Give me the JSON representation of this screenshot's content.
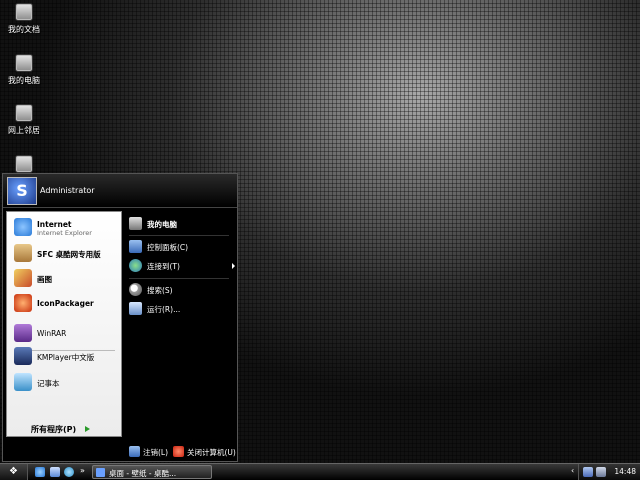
{
  "desktop_icons": [
    {
      "label": "我的文档",
      "icon": "my-documents-icon"
    },
    {
      "label": "我的电脑",
      "icon": "my-computer-icon"
    },
    {
      "label": "网上邻居",
      "icon": "network-places-icon"
    },
    {
      "label": "",
      "icon": "recycle-bin-icon"
    }
  ],
  "start_menu": {
    "user_name": "Administrator",
    "avatar_glyph": "S",
    "pinned": [
      {
        "title": "Internet",
        "subtitle": "Internet Explorer",
        "icon": "ie-icon",
        "color": "#2a7bd8"
      },
      {
        "title": "SFC 桌酷网专用版",
        "icon": "sfc-icon",
        "color": "#c89b5a"
      }
    ],
    "recent": [
      {
        "label": "画图",
        "icon": "paint-icon",
        "bold": true,
        "color": "#d8b43a"
      },
      {
        "label": "IconPackager",
        "icon": "iconpackager-icon",
        "bold": true,
        "color": "#d8451e"
      },
      {
        "label": "WinRAR",
        "icon": "winrar-icon",
        "bold": false,
        "color": "#7a3aa8"
      },
      {
        "label": "KMPlayer中文版",
        "icon": "kmplayer-icon",
        "bold": false,
        "color": "#2a4a8a"
      },
      {
        "label": "记事本",
        "icon": "notepad-icon",
        "bold": false,
        "color": "#4aa0d8"
      }
    ],
    "all_programs": "所有程序(P)",
    "right_items": [
      {
        "label": "我的电脑",
        "icon": "my-computer-icon",
        "bold": true,
        "arrow": false,
        "color": "#9a9a9a"
      },
      {
        "label": "控制面板(C)",
        "icon": "control-panel-icon",
        "bold": false,
        "arrow": false,
        "color": "#5a8ad8"
      },
      {
        "label": "连接到(T)",
        "icon": "connect-to-icon",
        "bold": false,
        "arrow": true,
        "color": "#3ab04a"
      },
      {
        "label": "搜索(S)",
        "icon": "search-icon",
        "bold": false,
        "arrow": false,
        "color": "#d8d8d8"
      },
      {
        "label": "运行(R)...",
        "icon": "run-icon",
        "bold": false,
        "arrow": false,
        "color": "#8ab0e8"
      }
    ],
    "logoff": "注销(L)",
    "shutdown": "关闭计算机(U)"
  },
  "taskbar": {
    "start_glyph": "❖",
    "quick_launch": [
      {
        "icon": "ie-quicklaunch-icon",
        "color": "#3a8ae8"
      },
      {
        "icon": "show-desktop-icon",
        "color": "#6aa0e8"
      },
      {
        "icon": "media-player-icon",
        "color": "#3aa0d8"
      }
    ],
    "quick_launch_more": "»",
    "window_title": "桌面 - 壁纸 - 桌酷...",
    "tray_expand": "‹",
    "tray_icons": [
      {
        "icon": "network-tray-icon",
        "color": "#7a9ad8"
      },
      {
        "icon": "volume-tray-icon",
        "color": "#9aa8c8"
      }
    ],
    "clock": "14:48"
  }
}
